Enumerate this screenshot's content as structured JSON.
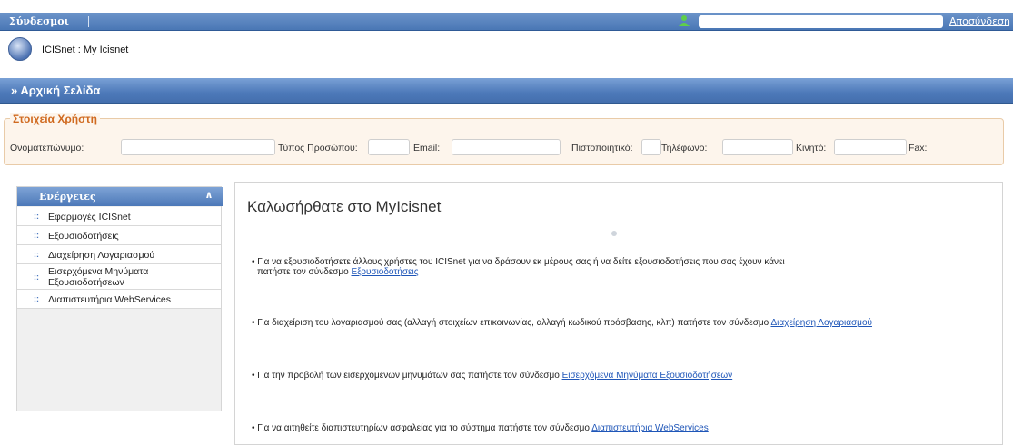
{
  "topbar": {
    "links_label": "Σύνδεσμοι",
    "logout_label": "Αποσύνδεση"
  },
  "app": {
    "title": "ICISnet : My Icisnet"
  },
  "section": {
    "title": "» Αρχική Σελίδα"
  },
  "user_info": {
    "legend": "Στοιχεία Χρήστη",
    "fields": {
      "name_label": "Ονοματεπώνυμο:",
      "person_type_label": "Τύπος Προσώπου:",
      "email_label": "Email:",
      "certificate_label": "Πιστοποιητικό:",
      "phone_label": "Τηλέφωνο:",
      "mobile_label": "Κινητό:",
      "fax_label": "Fax:"
    }
  },
  "menu": {
    "title": "Ενέργειες",
    "items": [
      {
        "label": "Εφαρμογές ICISnet"
      },
      {
        "label": "Εξουσιοδοτήσεις"
      },
      {
        "label": "Διαχείρηση Λογαριασμού"
      },
      {
        "label": "Εισερχόμενα Μηνύματα Εξουσιοδοτήσεων"
      },
      {
        "label": "Διαπιστευτήρια WebServices"
      }
    ]
  },
  "content": {
    "welcome": "Καλωσήρθατε στο MyIcisnet",
    "p1_text": "• Για να εξουσιοδοτήσετε άλλους χρήστες του ICISnet για να δράσουν εκ μέρους σας ή να δείτε εξουσιοδοτήσεις που σας έχουν κάνει",
    "p1_text2": "πατήστε τον σύνδεσμο ",
    "p1_link": "Εξουσιοδοτήσεις",
    "p2_text": "• Για διαχείριση του λογαριασμού σας (αλλαγή στοιχείων επικοινωνίας, αλλαγή κωδικού πρόσβασης, κλπ) πατήστε τον σύνδεσμο ",
    "p2_link": "Διαχείρηση Λογαριασμού",
    "p3_text": "• Για την προβολή των εισερχομένων μηνυμάτων σας πατήστε τον σύνδεσμο ",
    "p3_link": "Εισερχόμενα Μηνύματα Εξουσιοδοτήσεων",
    "p4_text": "• Για να αιτηθείτε διαπιστευτηρίων ασφαλείας για το σύστημα πατήστε τον σύνδεσμο ",
    "p4_link": "Διαπιστευτήρια WebServices"
  }
}
